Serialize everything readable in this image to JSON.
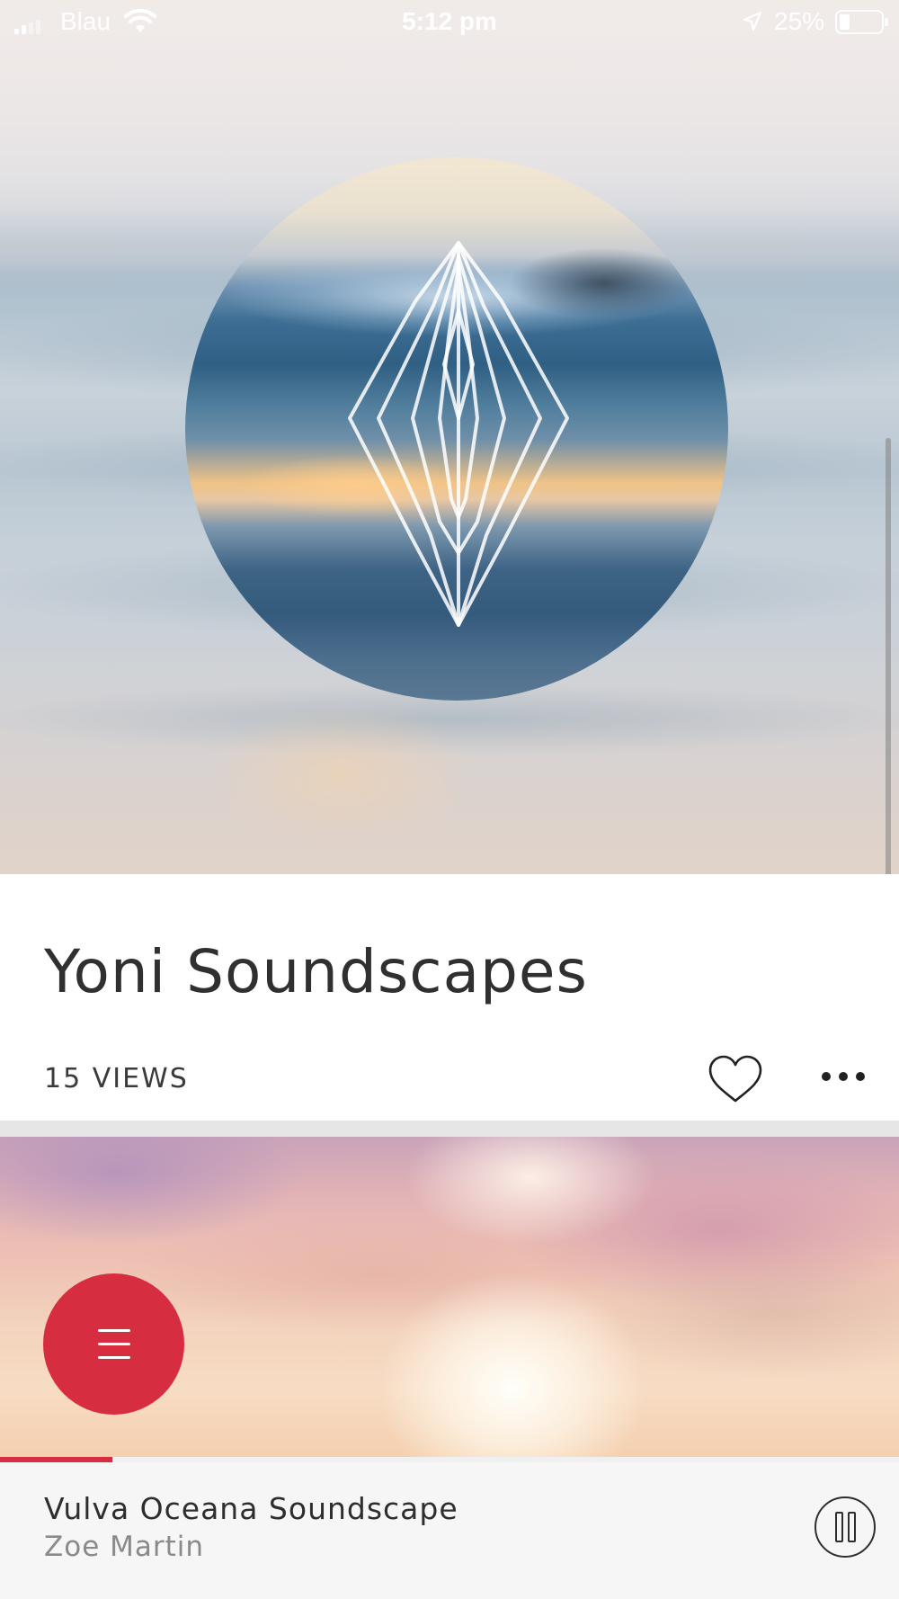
{
  "status_bar": {
    "carrier": "Blau",
    "time": "5:12 pm",
    "battery_percent": "25%",
    "battery_level": 0.25,
    "icons": [
      "signal-icon",
      "wifi-icon",
      "location-arrow-icon",
      "battery-icon"
    ]
  },
  "album": {
    "title": "Yoni Soundscapes",
    "views": "15 VIEWS",
    "artwork_icon": "crystal-outline-icon",
    "actions": [
      "heart-icon",
      "more-dots-icon"
    ]
  },
  "menu_button": {
    "icon": "hamburger-menu-icon",
    "color": "#d72d40"
  },
  "now_playing": {
    "track_title": "Vulva Oceana Soundscape",
    "artist": "Zoe Martin",
    "progress": 0.125,
    "state_icon": "pause-icon"
  },
  "colors": {
    "accent": "#d72d40",
    "player_background": "#f6f6f6",
    "divider": "#e6e6e6"
  }
}
